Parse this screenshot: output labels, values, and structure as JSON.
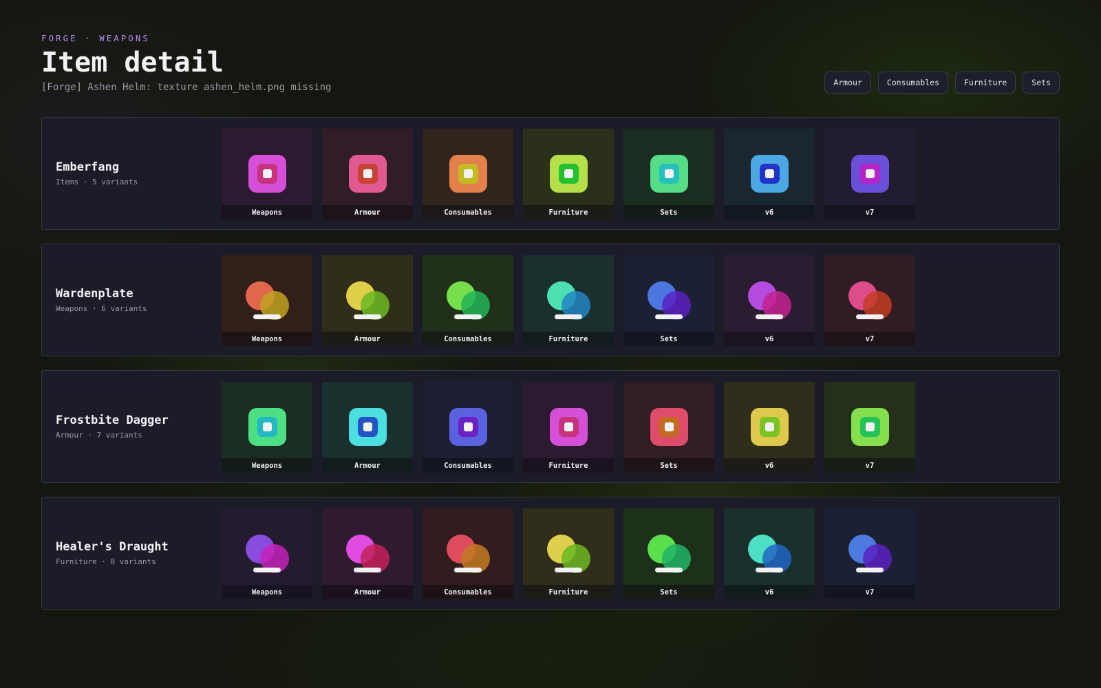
{
  "header": {
    "eyebrow": "FORGE · WEAPONS",
    "title": "Item detail",
    "subtitle": "[Forge] Ashen Helm: texture ashen_helm.png missing"
  },
  "filters": [
    "Armour",
    "Consumables",
    "Furniture",
    "Sets"
  ],
  "rows": [
    {
      "name": "Emberfang",
      "meta": "Items · 5 variants",
      "icon": "square-icon",
      "tiles": [
        {
          "label": "Weapons",
          "bg": "#2c1a30",
          "c1": "#d54fd8",
          "c2": "#c8327f"
        },
        {
          "label": "Armour",
          "bg": "#311d27",
          "c1": "#e05a91",
          "c2": "#c94235"
        },
        {
          "label": "Consumables",
          "bg": "#31241d",
          "c1": "#e3804b",
          "c2": "#c4ba22"
        },
        {
          "label": "Furniture",
          "bg": "#2a3019",
          "c1": "#b5e04b",
          "c2": "#22c12f"
        },
        {
          "label": "Sets",
          "bg": "#1b2d20",
          "c1": "#54dc87",
          "c2": "#24c0b9"
        },
        {
          "label": "v6",
          "bg": "#1a2731",
          "c1": "#4ca8e3",
          "c2": "#2233c8"
        },
        {
          "label": "v7",
          "bg": "#221c31",
          "c1": "#6c4fd8",
          "c2": "#b424c8"
        }
      ]
    },
    {
      "name": "Wardenplate",
      "meta": "Weapons · 6 variants",
      "icon": "potion-icon",
      "tiles": [
        {
          "label": "Weapons",
          "bg": "#321f1a",
          "c1": "#e0674c",
          "c2": "#c0a222"
        },
        {
          "label": "Armour",
          "bg": "#302e19",
          "c1": "#dfcf49",
          "c2": "#6cb823"
        },
        {
          "label": "Consumables",
          "bg": "#213019",
          "c1": "#78df4c",
          "c2": "#22b456"
        },
        {
          "label": "Furniture",
          "bg": "#19302d",
          "c1": "#4cdfb0",
          "c2": "#2285c4"
        },
        {
          "label": "Sets",
          "bg": "#1b2034",
          "c1": "#4c77df",
          "c2": "#5a22c4"
        },
        {
          "label": "v6",
          "bg": "#2a1c31",
          "c1": "#b44cdf",
          "c2": "#c4228f"
        },
        {
          "label": "v7",
          "bg": "#321c23",
          "c1": "#df4c8a",
          "c2": "#c43c22"
        }
      ]
    },
    {
      "name": "Frostbite Dagger",
      "meta": "Armour · 7 variants",
      "icon": "square-icon",
      "tiles": [
        {
          "label": "Weapons",
          "bg": "#1b2d20",
          "c1": "#4cdf84",
          "c2": "#22b8c4"
        },
        {
          "label": "Armour",
          "bg": "#19302f",
          "c1": "#4cdfdf",
          "c2": "#2254c4"
        },
        {
          "label": "Consumables",
          "bg": "#1c1f34",
          "c1": "#5a62df",
          "c2": "#6a22c4"
        },
        {
          "label": "Furniture",
          "bg": "#2c1a30",
          "c1": "#d54fd8",
          "c2": "#c8327f"
        },
        {
          "label": "Sets",
          "bg": "#311d22",
          "c1": "#df4c6a",
          "c2": "#c46a22"
        },
        {
          "label": "v6",
          "bg": "#302d1a",
          "c1": "#dfc94c",
          "c2": "#7ac422"
        },
        {
          "label": "v7",
          "bg": "#24301a",
          "c1": "#86df4c",
          "c2": "#22c457"
        }
      ]
    },
    {
      "name": "Healer's Draught",
      "meta": "Furniture · 8 variants",
      "icon": "potion-icon",
      "tiles": [
        {
          "label": "Weapons",
          "bg": "#251b31",
          "c1": "#8a4cdf",
          "c2": "#c422b8"
        },
        {
          "label": "Armour",
          "bg": "#301a30",
          "c1": "#df4cdf",
          "c2": "#c4225a"
        },
        {
          "label": "Consumables",
          "bg": "#321c1e",
          "c1": "#df4c5e",
          "c2": "#c47a22"
        },
        {
          "label": "Furniture",
          "bg": "#302d1a",
          "c1": "#dfcf4c",
          "c2": "#6cb823"
        },
        {
          "label": "Sets",
          "bg": "#1d3019",
          "c1": "#5cdf4c",
          "c2": "#22b468"
        },
        {
          "label": "v6",
          "bg": "#19302d",
          "c1": "#4cdfc4",
          "c2": "#2266c4"
        },
        {
          "label": "v7",
          "bg": "#1b2034",
          "c1": "#4c7adf",
          "c2": "#5a22c4"
        }
      ]
    }
  ]
}
